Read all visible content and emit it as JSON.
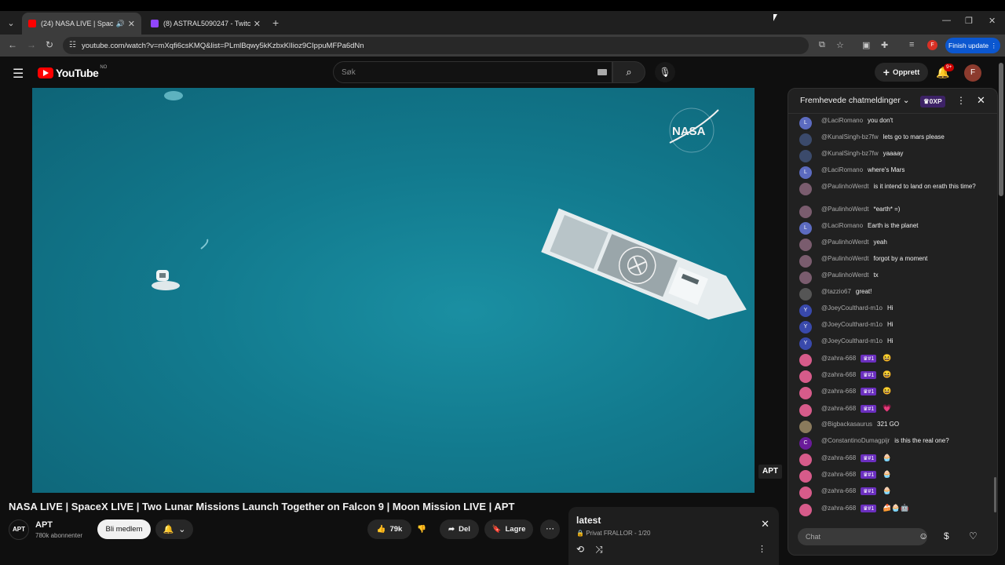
{
  "browser": {
    "tabs": [
      {
        "title": "(24) NASA LIVE | SpaceX LIV",
        "favicon_color": "#ff0000"
      },
      {
        "title": "(8) ASTRAL5090247 - Twitch",
        "favicon_color": "#9146ff"
      }
    ],
    "url": "youtube.com/watch?v=mXqfi6csKMQ&list=PLmlBqwy5kKzbxKlIioz9CIppuMFPa6dNn",
    "profile_initial": "F",
    "finish_update_label": "Finish update"
  },
  "youtube": {
    "logo_text": "YouTube",
    "country_code": "NO",
    "search_placeholder": "Søk",
    "create_label": "Opprett",
    "notification_count": "9+",
    "avatar_initial": "F"
  },
  "video": {
    "overlay_logo": "NASA",
    "channel_watermark": "APT",
    "title": "NASA LIVE | SpaceX LIVE | Two Lunar Missions Launch Together on Falcon 9 | Moon Mission LIVE | APT",
    "channel_avatar": "APT",
    "channel_name": "APT",
    "subscribers": "780k abonnenter",
    "join_label": "Bli medlem",
    "likes": "79k",
    "share_label": "Del",
    "save_label": "Lagre"
  },
  "playlist": {
    "title": "latest",
    "meta": "Privat FRALLOR - 1/20"
  },
  "chat": {
    "header_title": "Fremhevede chatmeldinger",
    "xp_label": "0XP",
    "input_placeholder": "Chat",
    "messages": [
      {
        "author": "@LaciRomano",
        "text": "you don't",
        "avatar": "L",
        "avatar_color": "#5c6bc0"
      },
      {
        "author": "@KunalSingh-bz7fw",
        "text": "lets go to mars please",
        "avatar": "",
        "avatar_color": "#3b4a6b"
      },
      {
        "author": "@KunalSingh-bz7fw",
        "text": "yaaaay",
        "avatar": "",
        "avatar_color": "#3b4a6b"
      },
      {
        "author": "@LaciRomano",
        "text": "where's Mars",
        "avatar": "L",
        "avatar_color": "#5c6bc0"
      },
      {
        "author": "@PaulinhoWerdt",
        "text": "is it intend to land on erath this time?",
        "avatar": "",
        "avatar_color": "#7a5c6e"
      },
      {
        "author": "@PaulinhoWerdt",
        "text": "*earth* =)",
        "avatar": "",
        "avatar_color": "#7a5c6e"
      },
      {
        "author": "@LaciRomano",
        "text": "Earth is the planet",
        "avatar": "L",
        "avatar_color": "#5c6bc0"
      },
      {
        "author": "@PaulinhoWerdt",
        "text": "yeah",
        "avatar": "",
        "avatar_color": "#7a5c6e"
      },
      {
        "author": "@PaulinhoWerdt",
        "text": "forgot by a moment",
        "avatar": "",
        "avatar_color": "#7a5c6e"
      },
      {
        "author": "@PaulinhoWerdt",
        "text": "tx",
        "avatar": "",
        "avatar_color": "#7a5c6e"
      },
      {
        "author": "@tazzio67",
        "text": "great!",
        "avatar": "",
        "avatar_color": "#555"
      },
      {
        "author": "@JoeyCoulthard-m1o",
        "text": "Hi",
        "avatar": "Y",
        "avatar_color": "#3949ab"
      },
      {
        "author": "@JoeyCoulthard-m1o",
        "text": "Hi",
        "avatar": "Y",
        "avatar_color": "#3949ab"
      },
      {
        "author": "@JoeyCoulthard-m1o",
        "text": "Hi",
        "avatar": "Y",
        "avatar_color": "#3949ab"
      },
      {
        "author": "@zahra-668",
        "text": "",
        "badge": "#1",
        "emoji": "😆",
        "avatar": "",
        "avatar_color": "#d65b8a"
      },
      {
        "author": "@zahra-668",
        "text": "",
        "badge": "#1",
        "emoji": "😆",
        "avatar": "",
        "avatar_color": "#d65b8a"
      },
      {
        "author": "@zahra-668",
        "text": "",
        "badge": "#1",
        "emoji": "😆",
        "avatar": "",
        "avatar_color": "#d65b8a"
      },
      {
        "author": "@zahra-668",
        "text": "",
        "badge": "#1",
        "emoji": "💗",
        "avatar": "",
        "avatar_color": "#d65b8a"
      },
      {
        "author": "@Bigbackasaurus",
        "text": "321 GO",
        "avatar": "",
        "avatar_color": "#8a7a5c"
      },
      {
        "author": "@ConstantinoDumagpijr",
        "text": "is this the real one?",
        "avatar": "C",
        "avatar_color": "#6a1b9a"
      },
      {
        "author": "@zahra-668",
        "text": "",
        "badge": "#1",
        "emoji": "🧁",
        "avatar": "",
        "avatar_color": "#d65b8a"
      },
      {
        "author": "@zahra-668",
        "text": "",
        "badge": "#1",
        "emoji": "🧁",
        "avatar": "",
        "avatar_color": "#d65b8a"
      },
      {
        "author": "@zahra-668",
        "text": "",
        "badge": "#1",
        "emoji": "🧁",
        "avatar": "",
        "avatar_color": "#d65b8a"
      },
      {
        "author": "@zahra-668",
        "text": "",
        "badge": "#1",
        "emoji": "🍰🧁🤖",
        "avatar": "",
        "avatar_color": "#d65b8a"
      }
    ]
  }
}
